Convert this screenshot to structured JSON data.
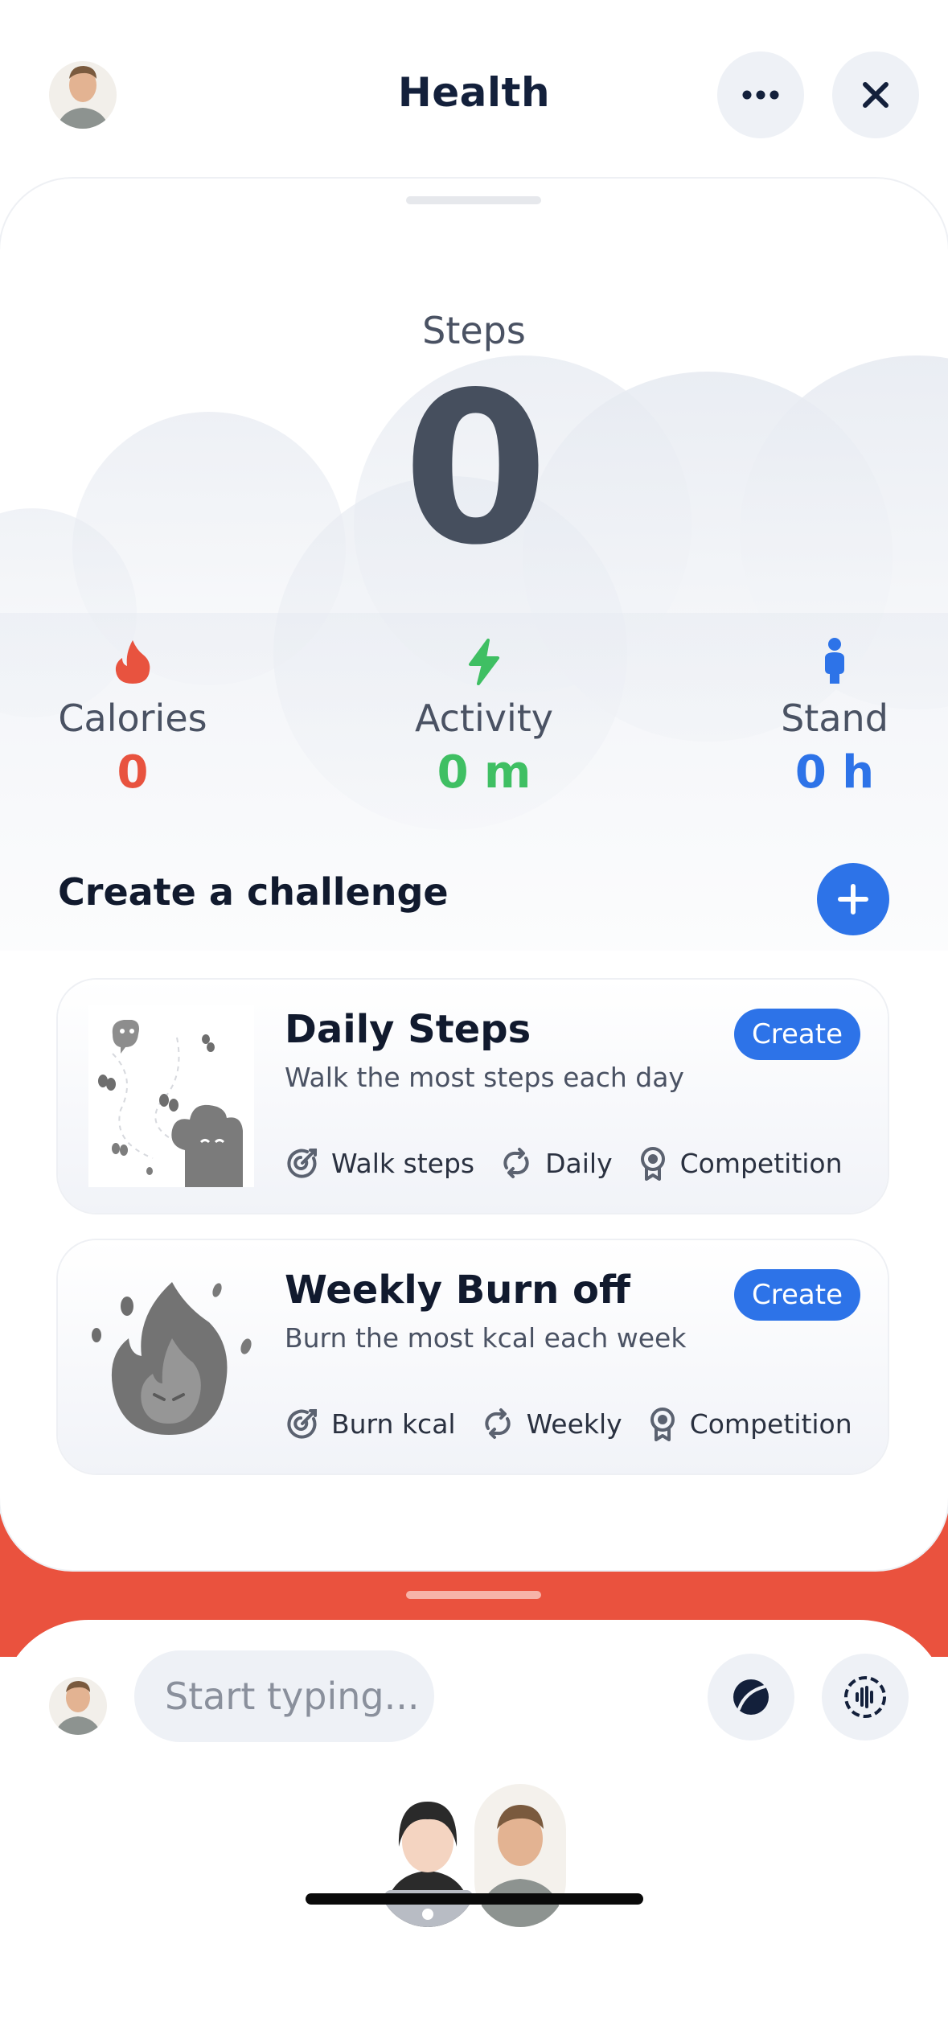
{
  "header": {
    "title": "Health"
  },
  "steps": {
    "label": "Steps",
    "value": "0"
  },
  "metrics": [
    {
      "label": "Calories",
      "value": "0",
      "color": "#e8533f",
      "icon": "flame-icon"
    },
    {
      "label": "Activity",
      "value": "0 m",
      "color": "#3fbf63",
      "icon": "bolt-icon"
    },
    {
      "label": "Stand",
      "value": "0 h",
      "color": "#2d73e8",
      "icon": "standing-person-icon"
    }
  ],
  "challenge_section": {
    "title": "Create a challenge"
  },
  "challenges": [
    {
      "title": "Daily Steps",
      "description": "Walk the most steps each day",
      "button": "Create",
      "tags": [
        "Walk steps",
        "Daily",
        "Competition"
      ]
    },
    {
      "title": "Weekly Burn off",
      "description": "Burn the most kcal each week",
      "button": "Create",
      "tags": [
        "Burn kcal",
        "Weekly",
        "Competition"
      ]
    }
  ],
  "composer": {
    "placeholder": "Start typing..."
  },
  "colors": {
    "accent": "#2d73e8",
    "brand_red": "#ea523e"
  }
}
